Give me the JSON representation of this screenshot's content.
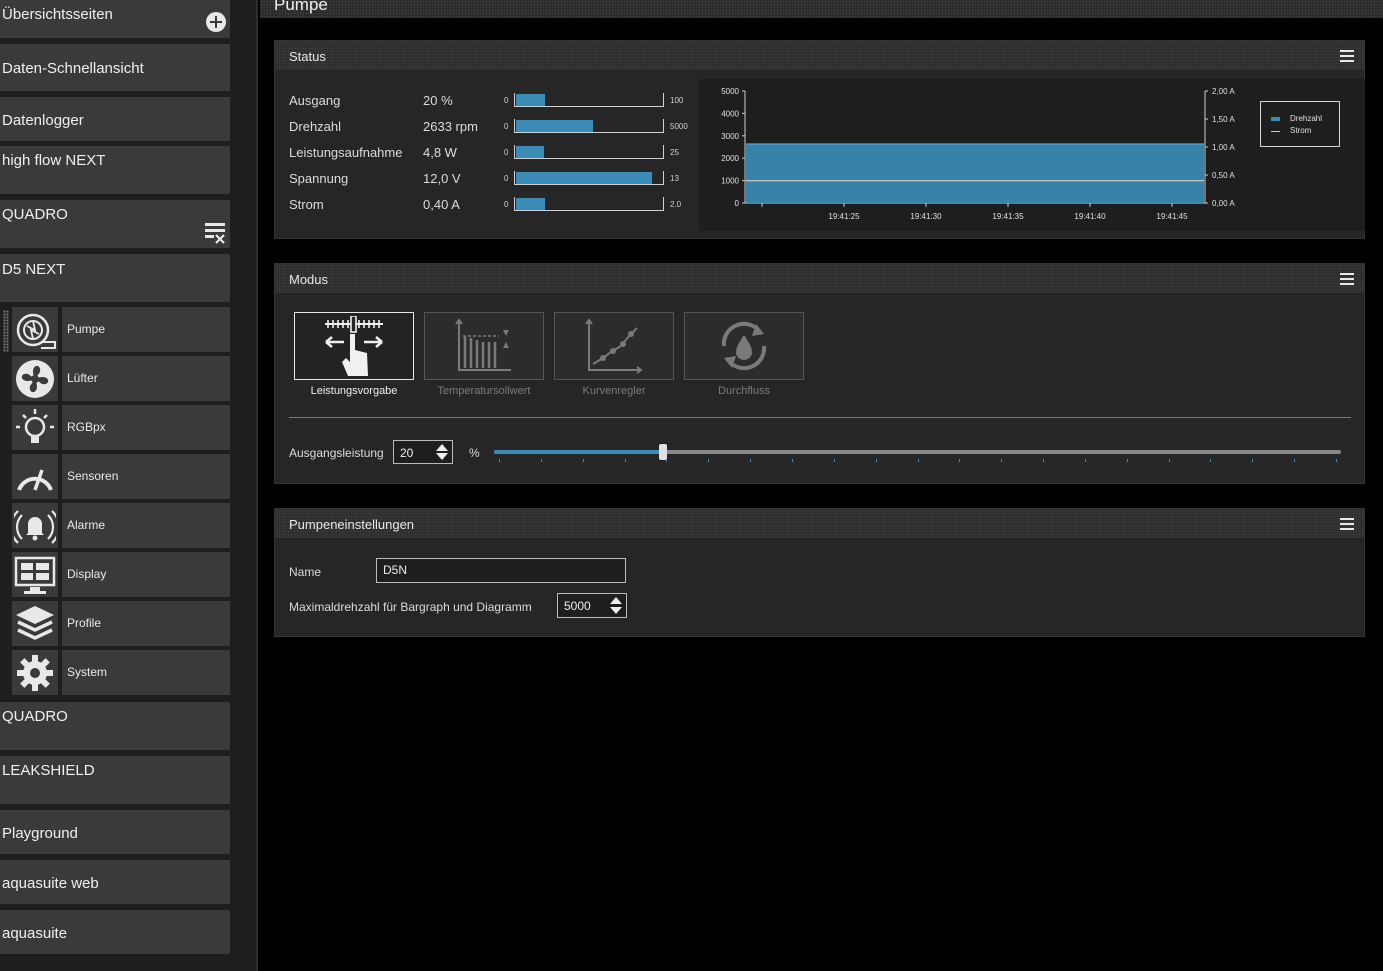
{
  "sidebar": {
    "items_top": [
      {
        "label": "Übersichtsseiten"
      },
      {
        "label": "Daten-Schnellansicht"
      },
      {
        "label": "Datenlogger"
      },
      {
        "label": "high flow NEXT"
      },
      {
        "label": "QUADRO"
      },
      {
        "label": "D5 NEXT"
      }
    ],
    "subitems": [
      {
        "label": "Pumpe",
        "icon": "pump-icon"
      },
      {
        "label": "Lüfter",
        "icon": "fan-icon"
      },
      {
        "label": "RGBpx",
        "icon": "lightbulb-icon"
      },
      {
        "label": "Sensoren",
        "icon": "gauge-icon"
      },
      {
        "label": "Alarme",
        "icon": "alarm-bell-icon"
      },
      {
        "label": "Display",
        "icon": "display-icon"
      },
      {
        "label": "Profile",
        "icon": "layers-icon"
      },
      {
        "label": "System",
        "icon": "gear-icon"
      }
    ],
    "items_bottom": [
      {
        "label": "QUADRO"
      },
      {
        "label": "LEAKSHIELD"
      },
      {
        "label": "Playground"
      },
      {
        "label": "aquasuite web"
      },
      {
        "label": "aquasuite"
      }
    ]
  },
  "page": {
    "title": "Pumpe"
  },
  "status": {
    "title": "Status",
    "accent": "#3a8bb5",
    "rows": [
      {
        "name": "Ausgang",
        "value": "20 %",
        "min": "0",
        "max": "100",
        "level": 0.2
      },
      {
        "name": "Drehzahl",
        "value": "2633 rpm",
        "min": "0",
        "max": "5000",
        "level": 0.527
      },
      {
        "name": "Leistungsaufnahme",
        "value": "4,8 W",
        "min": "0",
        "max": "25",
        "level": 0.192
      },
      {
        "name": "Spannung",
        "value": "12,0 V",
        "min": "0",
        "max": "13",
        "level": 0.923
      },
      {
        "name": "Strom",
        "value": "0,40 A",
        "min": "0",
        "max": "2.0",
        "level": 0.2
      }
    ]
  },
  "chart_data": {
    "type": "area",
    "x": [
      "19:41:25",
      "19:41:30",
      "19:41:35",
      "19:41:40",
      "19:41:45"
    ],
    "yticks_left": [
      "0",
      "1000",
      "2000",
      "3000",
      "4000",
      "5000"
    ],
    "yticks_right": [
      "0,00 A",
      "0,50 A",
      "1,00 A",
      "1,50 A",
      "2,00 A"
    ],
    "ylim_left": [
      0,
      5000
    ],
    "ylim_right": [
      0,
      2
    ],
    "series": [
      {
        "name": "Drehzahl",
        "axis": "left",
        "color": "#3a8bb5",
        "values": [
          2633,
          2633,
          2633,
          2633,
          2633,
          2633,
          2633
        ]
      },
      {
        "name": "Strom",
        "axis": "right",
        "color": "#c8c8c8",
        "values": [
          0.4,
          0.4,
          0.4,
          0.4,
          0.4,
          0.4,
          0.4
        ]
      }
    ],
    "legend": "top-right"
  },
  "modus": {
    "title": "Modus",
    "modes": [
      {
        "label": "Leistungsvorgabe",
        "active": true
      },
      {
        "label": "Temperatursollwert",
        "active": false
      },
      {
        "label": "Kurvenregler",
        "active": false
      },
      {
        "label": "Durchfluss",
        "active": false
      }
    ],
    "output_label": "Ausgangsleistung",
    "output_value": "20",
    "output_unit": "%",
    "slider_level": 0.2
  },
  "settings": {
    "title": "Pumpeneinstellungen",
    "name_label": "Name",
    "name_value": "D5N",
    "maxrpm_label": "Maximaldrehzahl für Bargraph und Diagramm",
    "maxrpm_value": "5000"
  }
}
